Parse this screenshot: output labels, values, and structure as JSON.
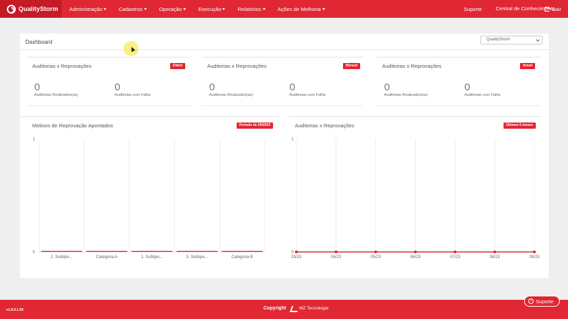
{
  "brand": {
    "name": "QualityStorm"
  },
  "nav": {
    "items": [
      {
        "label": "Administração"
      },
      {
        "label": "Cadastros"
      },
      {
        "label": "Operação"
      },
      {
        "label": "Execução"
      },
      {
        "label": "Relatórios"
      },
      {
        "label": "Ações de Melhoria"
      }
    ],
    "support": "Suporte",
    "knowledge": "Central de Conhecimento",
    "logout": "Sair"
  },
  "dashboard": {
    "title": "Dashboard",
    "unit_select": {
      "selected": "QualityStorm"
    }
  },
  "summary_panels": [
    {
      "title": "Auditorias x Reprovações",
      "badge": "Diário",
      "performed_value": "0",
      "performed_label": "Auditorias Realizados(as)",
      "failed_value": "0",
      "failed_label": "Auditorias com Falha"
    },
    {
      "title": "Auditorias x Reprovações",
      "badge": "Mensal",
      "performed_value": "0",
      "performed_label": "Auditorias Realizados(as)",
      "failed_value": "0",
      "failed_label": "Auditorias com Falha"
    },
    {
      "title": "Auditorias x Reprovações",
      "badge": "Anual",
      "performed_value": "0",
      "performed_label": "Auditorias Realizados(as)",
      "failed_value": "0",
      "failed_label": "Auditorias com Falha"
    }
  ],
  "charts_meta": {
    "reasons": {
      "title": "Motivos de Reprovação Apontados",
      "badge": "Período de 09/2023"
    },
    "trend": {
      "title": "Auditorias x Reprovações",
      "badge": "Últimos 6 meses"
    }
  },
  "chart_data": [
    {
      "type": "bar",
      "categories": [
        "2. Subtipo...",
        "Categoria A",
        "1. Subtipo...",
        "3. Subtipo...",
        "Categoria B"
      ],
      "values": [
        0,
        0,
        0,
        0,
        0
      ],
      "ylim": [
        0,
        1
      ],
      "yticks": [
        "0",
        "1"
      ],
      "grid": true,
      "color": "#e02733"
    },
    {
      "type": "line",
      "x": [
        "03/23",
        "04/23",
        "05/23",
        "06/23",
        "07/23",
        "08/23",
        "09/23"
      ],
      "values": [
        0,
        0,
        0,
        0,
        0,
        0,
        0
      ],
      "ylim": [
        0,
        1
      ],
      "yticks": [
        "0",
        "1"
      ],
      "grid": true,
      "color": "#e02733"
    }
  ],
  "footer": {
    "version": "v1.9.0.1.99",
    "copyright": "Copyright",
    "company": "MZ Tecnologia",
    "support_button": "Suporte"
  },
  "colors": {
    "brand_red": "#e02733",
    "brand_dark": "#c41b27"
  }
}
